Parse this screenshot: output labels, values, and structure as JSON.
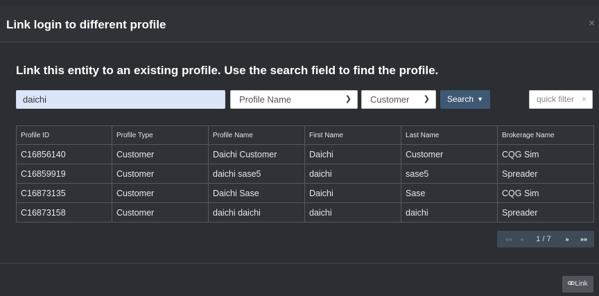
{
  "modal": {
    "title": "Link login to different profile",
    "close_glyph": "×",
    "lead": "Link this entity to an existing profile. Use the search field to find the profile."
  },
  "search": {
    "value": "daichi",
    "field_select": "Profile Name",
    "type_select": "Customer",
    "button_label": "Search",
    "quick_filter_placeholder": "quick filter",
    "quick_filter_clear": "×"
  },
  "table": {
    "headers": [
      "Profile ID",
      "Profile Type",
      "Profile Name",
      "First Name",
      "Last Name",
      "Brokerage Name"
    ],
    "rows": [
      [
        "C16856140",
        "Customer",
        "Daichi Customer",
        "Daichi",
        "Customer",
        "CQG Sim"
      ],
      [
        "C16859919",
        "Customer",
        "daichi sase5",
        "daichi",
        "sase5",
        "Spreader"
      ],
      [
        "C16873135",
        "Customer",
        "Daichi Sase",
        "Daichi",
        "Sase",
        "CQG Sim"
      ],
      [
        "C16873158",
        "Customer",
        "daichi daichi",
        "daichi",
        "daichi",
        "Spreader"
      ]
    ]
  },
  "pager": {
    "first": "««",
    "prev": "«",
    "page_text": "1 / 7",
    "next": "»",
    "last": "»»"
  },
  "footer": {
    "link_label": "Link",
    "link_icon": "link-icon"
  },
  "colors": {
    "background": "#2b2e33",
    "search_button": "#3f5873",
    "search_input": "#dbe6f6"
  }
}
